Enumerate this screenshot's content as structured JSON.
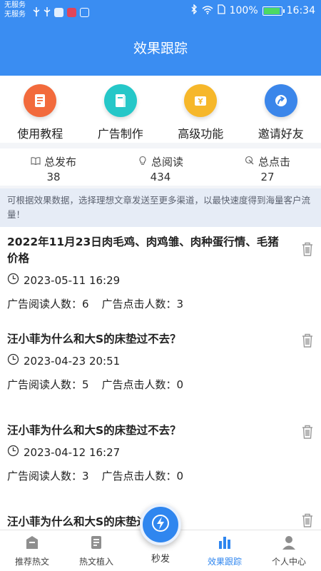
{
  "status_bar": {
    "carrier_line1": "无服务",
    "carrier_line2": "无服务",
    "battery": "100%",
    "time": "16:34"
  },
  "header": {
    "title": "效果跟踪"
  },
  "shortcuts": [
    {
      "label": "使用教程",
      "icon": "document-icon",
      "color": "#f26a3c"
    },
    {
      "label": "广告制作",
      "icon": "book-icon",
      "color": "#25c7c8"
    },
    {
      "label": "高级功能",
      "icon": "money-card-icon",
      "color": "#f6b72a"
    },
    {
      "label": "邀请好友",
      "icon": "share-arrow-icon",
      "color": "#3b86ea"
    }
  ],
  "stats": [
    {
      "label": "总发布",
      "value": "38",
      "icon": "book-open-icon"
    },
    {
      "label": "总阅读",
      "value": "434",
      "icon": "bulb-icon"
    },
    {
      "label": "总点击",
      "value": "27",
      "icon": "click-icon"
    }
  ],
  "notice": "可根据效果数据，选择理想文章发送至更多渠道，以最快速度得到海量客户流量！",
  "articles": [
    {
      "title": "2022年11月23日肉毛鸡、肉鸡雏、肉种蛋行情、毛猪价格",
      "time": "2023-05-11 16:29",
      "reads": "广告阅读人数：6",
      "clicks": "广告点击人数：3"
    },
    {
      "title": "汪小菲为什么和大S的床垫过不去？",
      "time": "2023-04-23 20:51",
      "reads": "广告阅读人数：5",
      "clicks": "广告点击人数：0"
    },
    {
      "title": "汪小菲为什么和大S的床垫过不去？",
      "time": "2023-04-12 16:27",
      "reads": "广告阅读人数：3",
      "clicks": "广告点击人数：0"
    },
    {
      "title": "汪小菲为什么和大S的床垫过不去？"
    }
  ],
  "tabbar": {
    "tabs": [
      {
        "label": "推荐热文",
        "icon": "home-icon"
      },
      {
        "label": "热文植入",
        "icon": "article-icon"
      },
      {
        "label": "秒发",
        "icon": "lightning-icon"
      },
      {
        "label": "效果跟踪",
        "icon": "bar-chart-icon",
        "active": true
      },
      {
        "label": "个人中心",
        "icon": "person-icon"
      }
    ]
  },
  "colors": {
    "primary": "#3a8df2",
    "active_tab": "#2f86ef"
  }
}
